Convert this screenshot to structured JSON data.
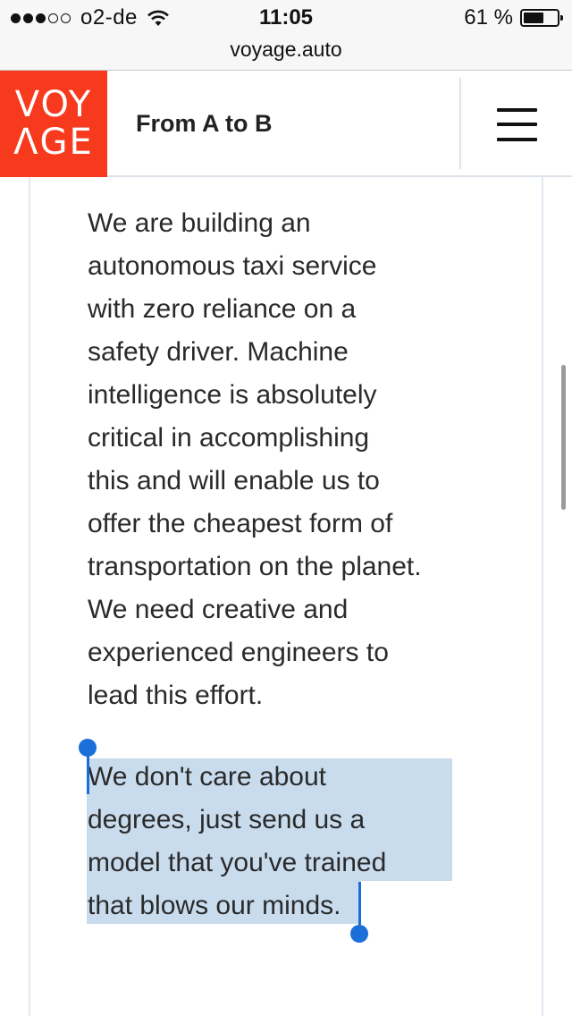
{
  "status_bar": {
    "carrier": "o2-de",
    "time": "11:05",
    "battery_percent_text": "61 %",
    "battery_level": 0.61,
    "signal_bars_filled": 3,
    "signal_bars_total": 5,
    "wifi": "wifi-icon"
  },
  "browser": {
    "url": "voyage.auto"
  },
  "header": {
    "logo_line1": "VOY",
    "logo_line2": "ΛGE",
    "tagline": "From A to B",
    "menu_icon": "hamburger-menu-icon",
    "brand_color": "#f7391d"
  },
  "content": {
    "paragraph1_lines": [
      "We are building an",
      "autonomous taxi service",
      "with zero reliance on a",
      "safety driver. Machine",
      "intelligence is absolutely",
      "critical in accomplishing",
      "this and will enable us to",
      "offer the cheapest form of",
      "transportation on the planet.",
      "We need creative and",
      "experienced engineers to",
      "lead this effort."
    ],
    "paragraph2_lines": [
      "We don't care about",
      "degrees, just send us a",
      "model that you've trained",
      "that blows our minds."
    ],
    "selection_color": "#c9dcee",
    "selection_handle_color": "#1a6fd8"
  }
}
